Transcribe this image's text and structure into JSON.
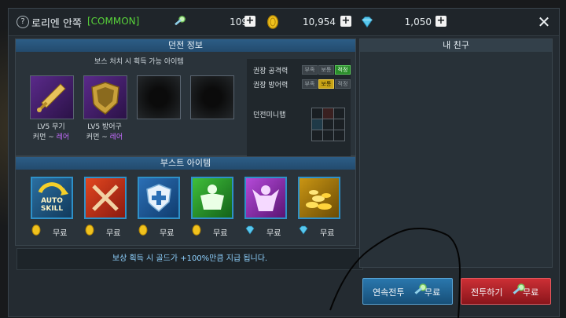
{
  "header": {
    "help_icon": "?",
    "title": "로리엔 안쪽",
    "rarity": "[COMMON]",
    "currencies": [
      {
        "icon": "key-icon",
        "value": "109"
      },
      {
        "icon": "gold-coin-icon",
        "value": "10,954"
      },
      {
        "icon": "gem-icon",
        "value": "1,050"
      }
    ],
    "plus": "+",
    "close": "✕"
  },
  "dungeon": {
    "heading": "던전 정보",
    "drop_caption": "보스 처치 시 획득 가능 아이템",
    "items": [
      {
        "label": "LV5 무기",
        "grade_prefix": "커먼 ~ ",
        "grade_suffix": "레어"
      },
      {
        "label": "LV5 방어구",
        "grade_prefix": "커먼 ~ ",
        "grade_suffix": "레어"
      }
    ],
    "stats": [
      {
        "label": "권장 공격력",
        "chips": [
          "부족",
          "보통",
          "적정"
        ],
        "active": "적정"
      },
      {
        "label": "권장 방어력",
        "chips": [
          "부족",
          "보통",
          "적정"
        ],
        "active": "보통"
      }
    ],
    "minimap_label": "던전미니맵"
  },
  "boost": {
    "heading": "부스트 아이템",
    "auto_skill_text": "AUTO SKILL",
    "items": [
      {
        "name": "auto-skill",
        "currency": "gold",
        "price": "무료"
      },
      {
        "name": "attack-boost",
        "currency": "gold",
        "price": "무료"
      },
      {
        "name": "defense-boost",
        "currency": "gold",
        "price": "무료"
      },
      {
        "name": "hp-boost",
        "currency": "gold",
        "price": "무료"
      },
      {
        "name": "power-boost",
        "currency": "gem",
        "price": "무료"
      },
      {
        "name": "gold-boost",
        "currency": "gem",
        "price": "무료"
      }
    ],
    "bonus_text": "보상 획득 시 골드가 +100%만큼 지급 됩니다."
  },
  "friends": {
    "heading": "내 친구"
  },
  "buttons": {
    "continuous_battle": "연속전투",
    "continuous_cost": "무료",
    "battle": "전투하기",
    "battle_cost": "무료"
  },
  "colors": {
    "accent_blue": "#2c5d86",
    "rare_purple": "#c56bff",
    "battle_red": "#b3232b",
    "continuous_blue": "#1f5f8c"
  }
}
